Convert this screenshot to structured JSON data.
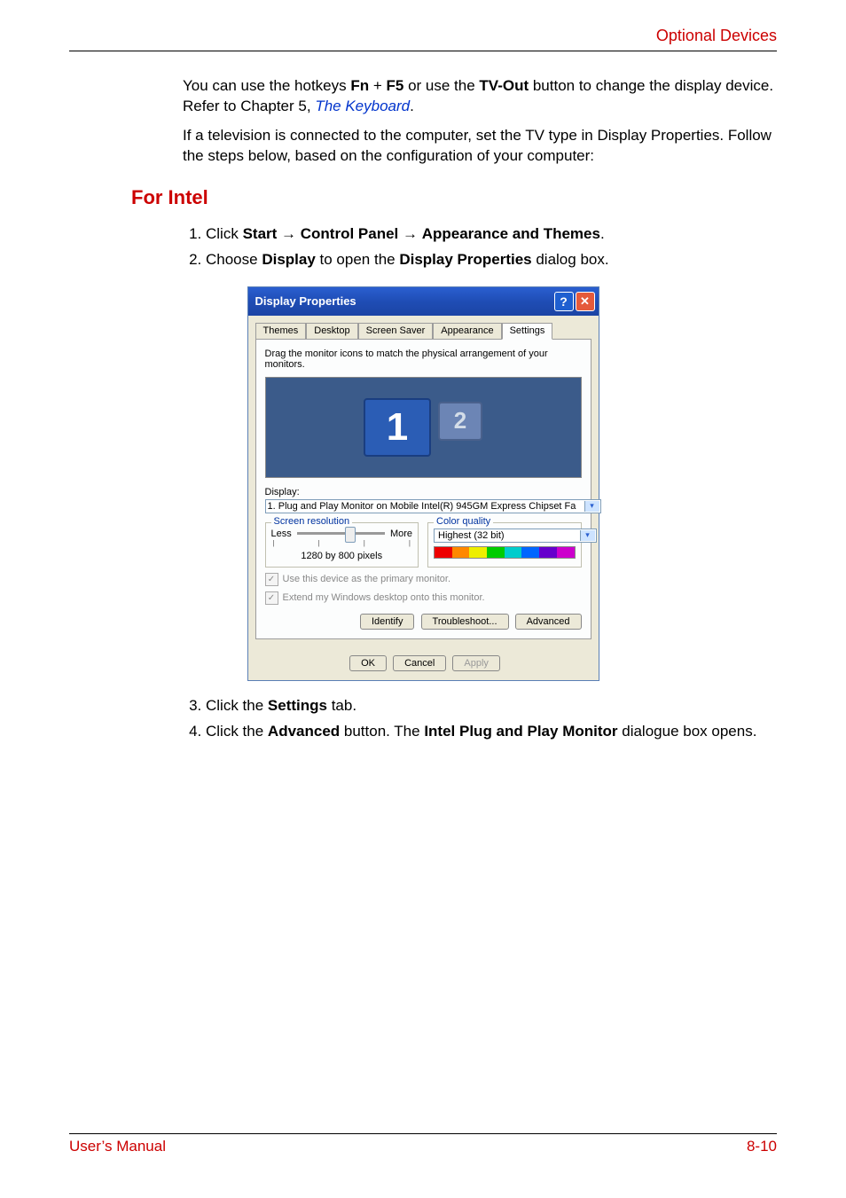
{
  "header": {
    "section_title": "Optional Devices"
  },
  "intro": {
    "p1_pre": "You can use the hotkeys ",
    "p1_fn": "Fn",
    "p1_plus": " + ",
    "p1_f5": "F5",
    "p1_mid": " or use the ",
    "p1_tvout": "TV-Out",
    "p1_post": " button to change the display device. Refer to Chapter 5, ",
    "p1_link": "The Keyboard",
    "p1_end": ".",
    "p2": "If a television is connected to the computer, set the TV type in Display Properties. Follow the steps below, based on the configuration of your computer:"
  },
  "section_heading": "For Intel",
  "steps_top": {
    "s1_pre": "Click ",
    "s1_start": "Start",
    "s1_arr": " → ",
    "s1_cp": "Control Panel",
    "s1_at": "Appearance and Themes",
    "s1_end": ".",
    "s2_pre": "Choose ",
    "s2_display": "Display",
    "s2_mid": " to open the ",
    "s2_dp": "Display Properties",
    "s2_end": " dialog box."
  },
  "dialog": {
    "title": "Display Properties",
    "help_icon": "?",
    "close_icon": "✕",
    "tabs": [
      "Themes",
      "Desktop",
      "Screen Saver",
      "Appearance",
      "Settings"
    ],
    "active_tab_index": 4,
    "drag_text": "Drag the monitor icons to match the physical arrangement of your monitors.",
    "monitors": {
      "m1": "1",
      "m2": "2"
    },
    "display_label": "Display:",
    "display_value": "1. Plug and Play Monitor on Mobile Intel(R) 945GM Express Chipset Fa",
    "screen_res": {
      "legend": "Screen resolution",
      "less": "Less",
      "more": "More",
      "value": "1280 by 800 pixels"
    },
    "color_quality": {
      "legend": "Color quality",
      "value": "Highest (32 bit)"
    },
    "cb1": "Use this device as the primary monitor.",
    "cb2": "Extend my Windows desktop onto this monitor.",
    "buttons_mid": {
      "identify": "Identify",
      "troubleshoot": "Troubleshoot...",
      "advanced": "Advanced"
    },
    "buttons_bottom": {
      "ok": "OK",
      "cancel": "Cancel",
      "apply": "Apply"
    }
  },
  "steps_bottom": {
    "s3_pre": "Click the ",
    "s3_settings": "Settings",
    "s3_post": " tab.",
    "s4_pre": "Click the ",
    "s4_adv": "Advanced",
    "s4_mid": " button. The ",
    "s4_intel": "Intel Plug and Play Monitor",
    "s4_post": " dialogue box opens."
  },
  "footer": {
    "left": "User’s Manual",
    "right": "8-10"
  }
}
